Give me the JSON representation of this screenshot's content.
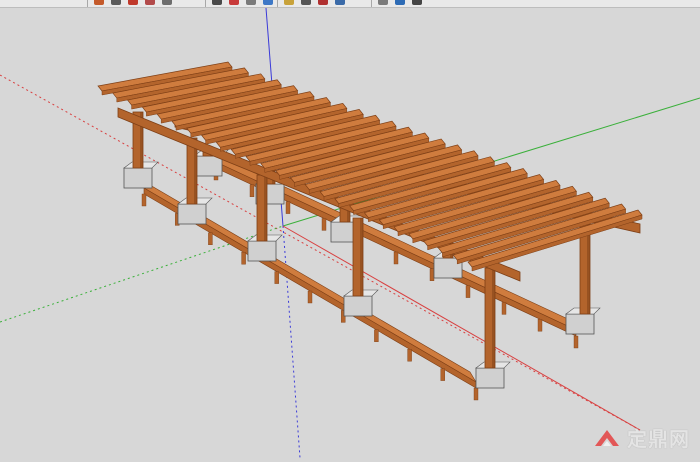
{
  "toolbar": {
    "buttons": [
      {
        "icon": "pencil-icon",
        "color": "#c45a2a"
      },
      {
        "icon": "line-icon",
        "color": "#5a5a5a"
      },
      {
        "icon": "arc-icon",
        "color": "#c0392b"
      },
      {
        "icon": "eraser-icon",
        "color": "#b24a4a"
      },
      {
        "icon": "paint-bucket-icon",
        "color": "#6d6d6d"
      },
      {
        "icon": "push-pull-icon",
        "color": "#4a4a4a"
      },
      {
        "icon": "move-icon",
        "color": "#c83a3a"
      },
      {
        "icon": "rotate-icon",
        "color": "#7a7a7a"
      },
      {
        "icon": "offset-icon",
        "color": "#3e78c6"
      },
      {
        "icon": "tape-icon",
        "color": "#c8a23a"
      },
      {
        "icon": "orbit-icon",
        "color": "#555555"
      },
      {
        "icon": "pan-icon",
        "color": "#b03030"
      },
      {
        "icon": "zoom-icon",
        "color": "#3a6aa8"
      },
      {
        "icon": "zoom-extents-icon",
        "color": "#7a7a7a"
      },
      {
        "icon": "previous-view-icon",
        "color": "#2d6bb5"
      },
      {
        "icon": "next-view-icon",
        "color": "#444444"
      }
    ]
  },
  "scene": {
    "axis_colors": {
      "red": "#d84040",
      "green": "#3ab03a",
      "blue": "#3a3ad8"
    },
    "wood_color": "#b3642c",
    "wood_dark": "#7e3f16",
    "wood_light": "#cf7c3e",
    "footing_color": "#d0d0d0"
  },
  "watermark": {
    "text": "定鼎网",
    "logo_color": "#e44a4a"
  }
}
